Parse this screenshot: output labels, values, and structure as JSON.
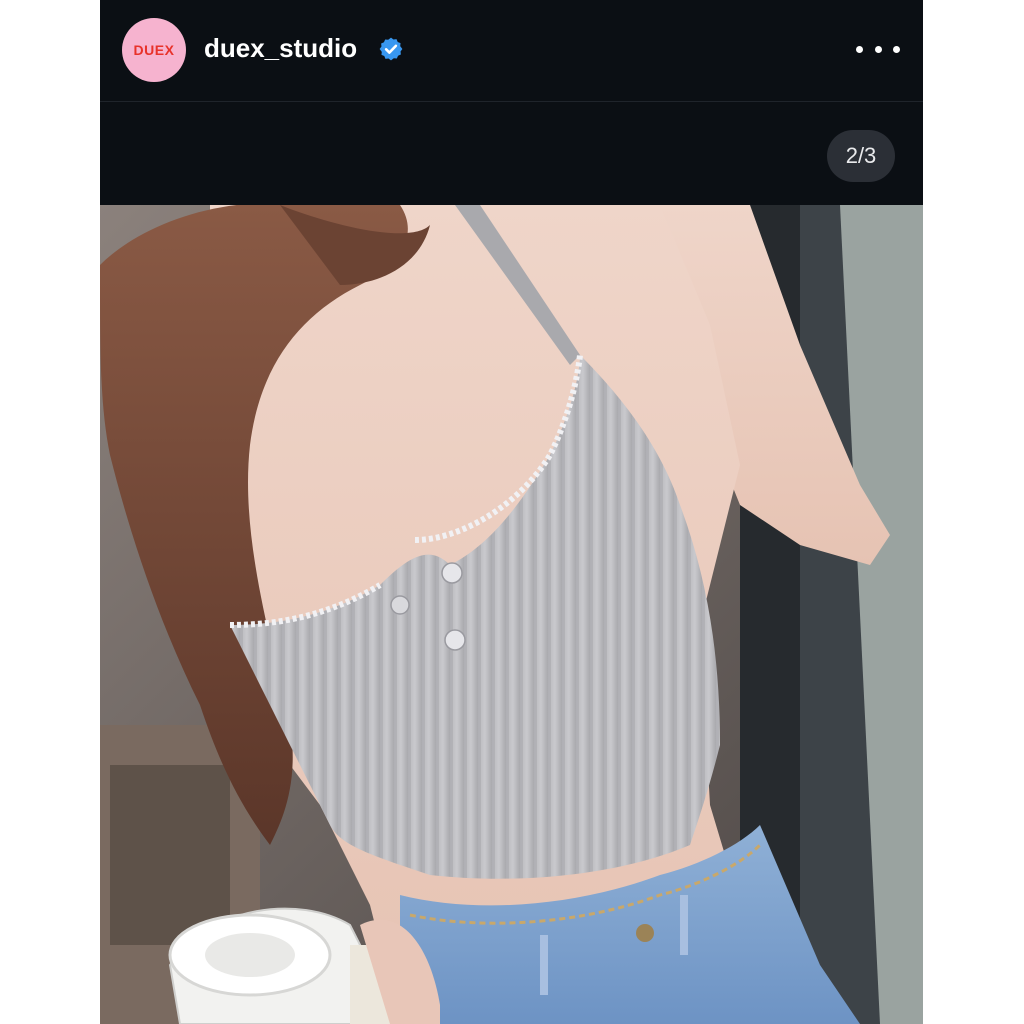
{
  "post": {
    "username": "duex_studio",
    "avatar_text": "DUEX",
    "verified": true,
    "more_icon": "more-horizontal-icon",
    "carousel_counter": "2/3"
  },
  "colors": {
    "background": "#0b0f14",
    "avatar_bg": "#f6b3cf",
    "avatar_text": "#e8322a",
    "verified_badge": "#3897f0"
  },
  "image": {
    "subject": "person in grey ribbed crop top with lace trim and light-wash jeans holding a coffee cup"
  }
}
